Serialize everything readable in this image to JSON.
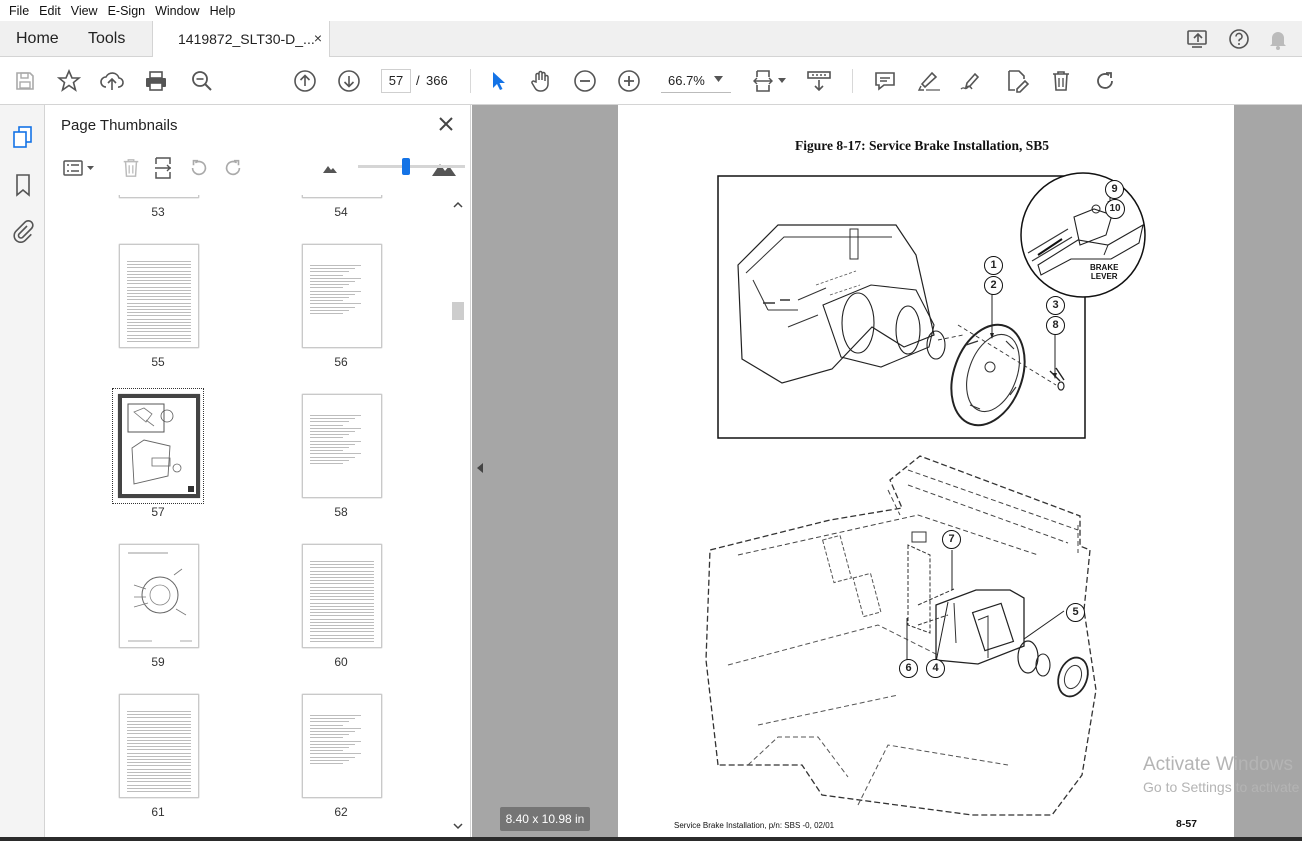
{
  "menu": [
    "File",
    "Edit",
    "View",
    "E-Sign",
    "Window",
    "Help"
  ],
  "tabs": {
    "home": "Home",
    "tools": "Tools",
    "document": "1419872_SLT30-D_...",
    "close_glyph": "×"
  },
  "toolbar": {
    "current_page": "57",
    "page_separator": "/",
    "total_pages": "366",
    "zoom": "66.7%"
  },
  "panel": {
    "title": "Page Thumbnails"
  },
  "thumbnails": [
    {
      "label": "53"
    },
    {
      "label": "54"
    },
    {
      "label": "55"
    },
    {
      "label": "56"
    },
    {
      "label": "57"
    },
    {
      "label": "58"
    },
    {
      "label": "59"
    },
    {
      "label": "60"
    },
    {
      "label": "61"
    },
    {
      "label": "62"
    }
  ],
  "selected_thumbnail": "57",
  "document": {
    "figure_title": "Figure 8-17:  Service Brake Installation, SB5",
    "callouts": [
      "1",
      "2",
      "3",
      "8",
      "9",
      "10",
      "7",
      "5",
      "6",
      "4"
    ],
    "inset_label_line1": "BRAKE",
    "inset_label_line2": "LEVER",
    "footer_left": "Service Brake Installation, p/n: SBS -0,  02/01",
    "footer_right": "8-57",
    "page_size": "8.40 x 10.98 in"
  },
  "watermark": {
    "line1": "Activate Windows",
    "line2": "Go to Settings to activate Windows."
  },
  "colors": {
    "accent": "#1473e6",
    "canvas": "#a6a6a6",
    "icon": "#555555"
  },
  "icons": [
    "save-icon",
    "star-icon",
    "upload-icon",
    "print-icon",
    "search-zoom-icon",
    "page-up-icon",
    "page-down-icon",
    "select-arrow-icon",
    "hand-icon",
    "zoom-out-icon",
    "zoom-in-icon",
    "fit-page-icon",
    "scroll-mode-icon",
    "comment-icon",
    "highlight-icon",
    "sign-icon",
    "edit-pdf-icon",
    "delete-icon",
    "redo-icon"
  ]
}
